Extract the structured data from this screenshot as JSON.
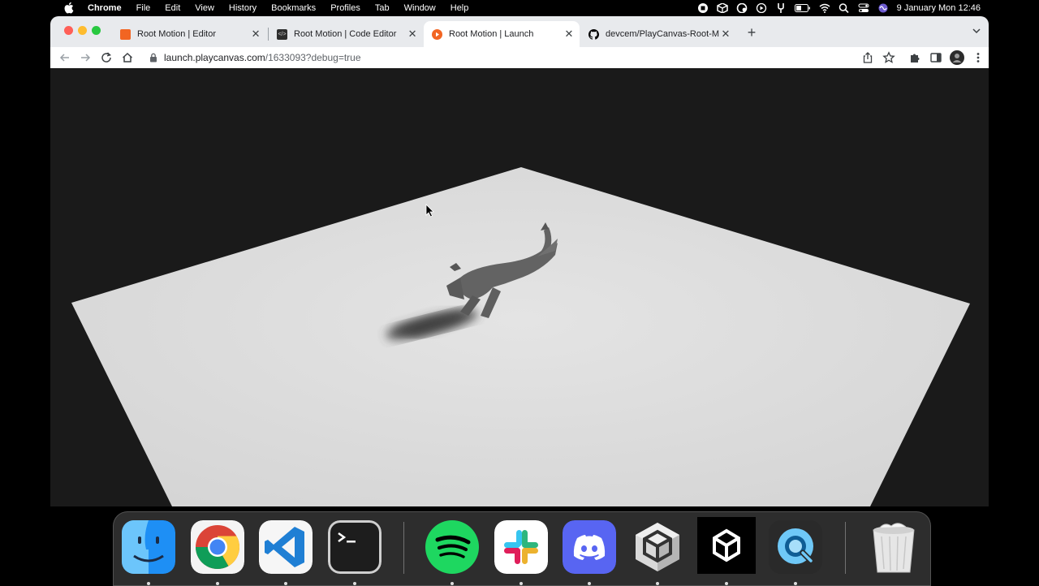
{
  "menubar": {
    "app_name": "Chrome",
    "items": [
      "File",
      "Edit",
      "View",
      "History",
      "Bookmarks",
      "Profiles",
      "Tab",
      "Window",
      "Help"
    ],
    "datetime": "9 January Mon  12:46"
  },
  "browser": {
    "tabs": [
      {
        "label": "Root Motion | Editor",
        "favicon": "playcanvas-editor-icon",
        "color": "#f26522"
      },
      {
        "label": "Root Motion | Code Editor",
        "favicon": "code-editor-icon",
        "color": "#2d2d2d"
      },
      {
        "label": "Root Motion | Launch",
        "favicon": "playcanvas-launch-icon",
        "color": "#f26522",
        "active": true
      },
      {
        "label": "devcem/PlayCanvas-Root-Mot",
        "favicon": "github-icon",
        "color": "#000000"
      }
    ],
    "url": {
      "host": "launch.playcanvas.com",
      "path": "/1633093?debug=true"
    }
  },
  "dock": {
    "apps": [
      "Finder",
      "Google Chrome",
      "Visual Studio Code",
      "Terminal",
      "Spotify",
      "Slack",
      "Discord",
      "Unity Hub",
      "Unity",
      "QuickTime Player",
      "Trash"
    ]
  }
}
